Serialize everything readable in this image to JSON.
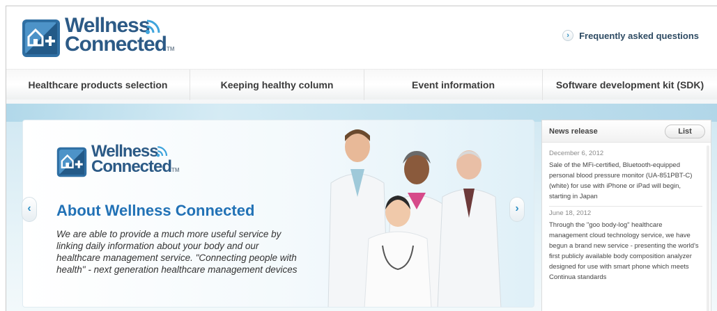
{
  "brand": {
    "line1": "Wellness",
    "line2": "Connected",
    "tm": "TM"
  },
  "header": {
    "faq_label": "Frequently asked questions",
    "faq_icon": "chevron-right-icon"
  },
  "nav": {
    "items": [
      {
        "label": "Healthcare products selection"
      },
      {
        "label": "Keeping healthy column"
      },
      {
        "label": "Event information"
      },
      {
        "label": "Software development kit (SDK)"
      }
    ]
  },
  "slide": {
    "title": "About Wellness Connected",
    "body": "We are able to provide a much more useful service by linking daily information about your body and our healthcare management service. \"Connecting people with health\" - next generation healthcare management devices",
    "prev_icon": "‹",
    "next_icon": "›"
  },
  "news": {
    "title": "News release",
    "list_label": "List",
    "items": [
      {
        "date": "December 6, 2012",
        "text": "Sale of the MFi-certified, Bluetooth-equipped personal blood pressure monitor (UA-851PBT-C) (white) for use with iPhone or iPad will begin, starting in Japan"
      },
      {
        "date": "June 18, 2012",
        "text": "Through the \"goo body-log\" healthcare management cloud technology service, we have begun a brand new service - presenting the world's first publicly available body composition analyzer designed for use with smart phone which meets Continua standards"
      }
    ]
  },
  "colors": {
    "brand_blue": "#2c5a86",
    "accent_blue": "#2272b6",
    "hero_bg": "#cfe7f2"
  }
}
